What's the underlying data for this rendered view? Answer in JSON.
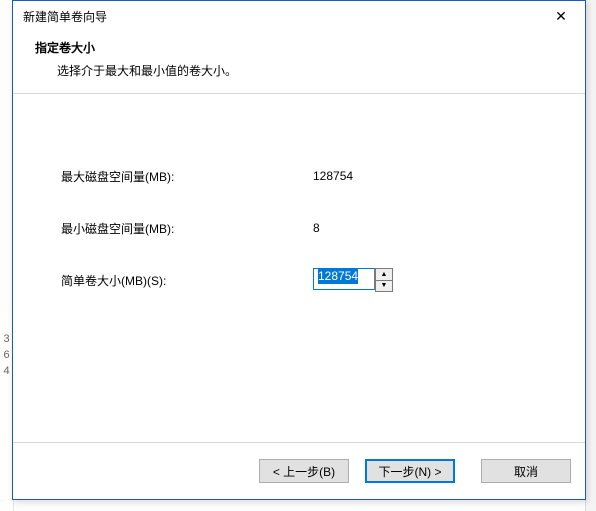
{
  "window": {
    "title": "新建简单卷向导",
    "close_glyph": "✕"
  },
  "header": {
    "title": "指定卷大小",
    "subtitle": "选择介于最大和最小值的卷大小。"
  },
  "fields": {
    "max_label": "最大磁盘空间量(MB):",
    "max_value": "128754",
    "min_label": "最小磁盘空间量(MB):",
    "min_value": "8",
    "size_label": "简单卷大小(MB)(S):",
    "size_value": "128754"
  },
  "spinner": {
    "up_glyph": "▲",
    "down_glyph": "▼"
  },
  "buttons": {
    "back": "< 上一步(B)",
    "next": "下一步(N) >",
    "cancel": "取消"
  },
  "behind": {
    "c1": "3",
    "c2": "6",
    "c3": "4"
  }
}
